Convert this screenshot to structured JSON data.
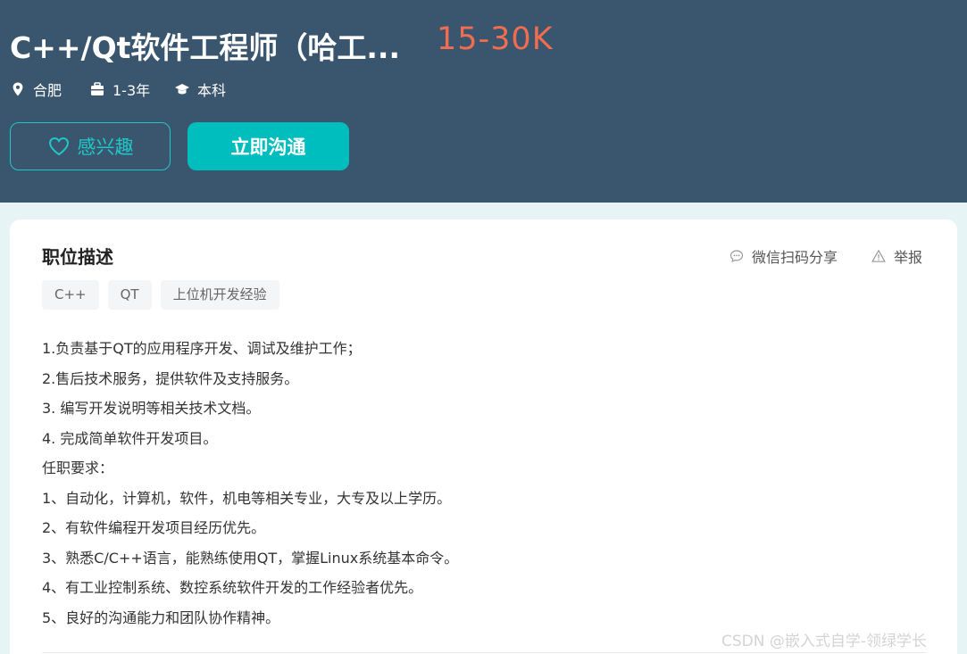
{
  "header": {
    "title": "C++/Qt软件工程师（哈工...",
    "salary": "15-30K",
    "city": "合肥",
    "experience": "1-3年",
    "education": "本科",
    "interest_label": "感兴趣",
    "chat_label": "立即沟通"
  },
  "card": {
    "title": "职位描述",
    "share_label": "微信扫码分享",
    "report_label": "举报",
    "tags": [
      "C++",
      "QT",
      "上位机开发经验"
    ],
    "lines": [
      "1.负责基于QT的应用程序开发、调试及维护工作；",
      "2.售后技术服务，提供软件及支持服务。",
      "3. 编写开发说明等相关技术文档。",
      "4. 完成简单软件开发项目。",
      "任职要求：",
      "1、自动化，计算机，软件，机电等相关专业，大专及以上学历。",
      "2、有软件编程开发项目经历优先。",
      "3、熟悉C/C++语言，能熟练使用QT，掌握Linux系统基本命令。",
      "4、有工业控制系统、数控系统软件开发的工作经验者优先。",
      "5、良好的沟通能力和团队协作精神。"
    ]
  },
  "watermark": "CSDN @嵌入式自学-领绿学长",
  "colors": {
    "header_bg": "#3a566e",
    "salary": "#f26d4f",
    "accent": "#00bebd",
    "accent_outline": "#1fc7c9"
  },
  "icons": {
    "city": "location-pin-icon",
    "experience": "briefcase-icon",
    "education": "graduation-cap-icon",
    "interest": "heart-icon",
    "share": "chat-bubble-icon",
    "report": "warning-icon"
  }
}
